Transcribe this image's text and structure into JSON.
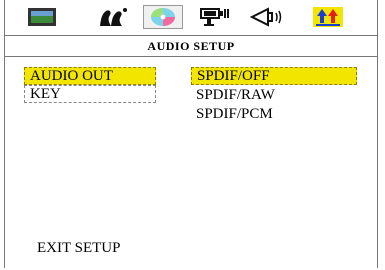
{
  "tabs": [
    {
      "icon": "monitor-icon",
      "selected": false
    },
    {
      "icon": "language-people-icon",
      "selected": false
    },
    {
      "icon": "audio-disc-icon",
      "selected": true
    },
    {
      "icon": "video-projector-icon",
      "selected": false
    },
    {
      "icon": "speaker-icon",
      "selected": false
    },
    {
      "icon": "preference-arrows-icon",
      "selected": false
    }
  ],
  "header": {
    "title": "AUDIO SETUP"
  },
  "left_menu": [
    {
      "label": "AUDIO OUT",
      "state": "highlighted"
    },
    {
      "label": "KEY",
      "state": "outlined"
    }
  ],
  "right_menu": [
    {
      "label": "SPDIF/OFF",
      "state": "highlighted"
    },
    {
      "label": "SPDIF/RAW",
      "state": "normal"
    },
    {
      "label": "SPDIF/PCM",
      "state": "normal"
    }
  ],
  "footer": {
    "exit_label": "EXIT SETUP"
  },
  "colors": {
    "highlight": "#f2e600",
    "border": "#777777"
  }
}
